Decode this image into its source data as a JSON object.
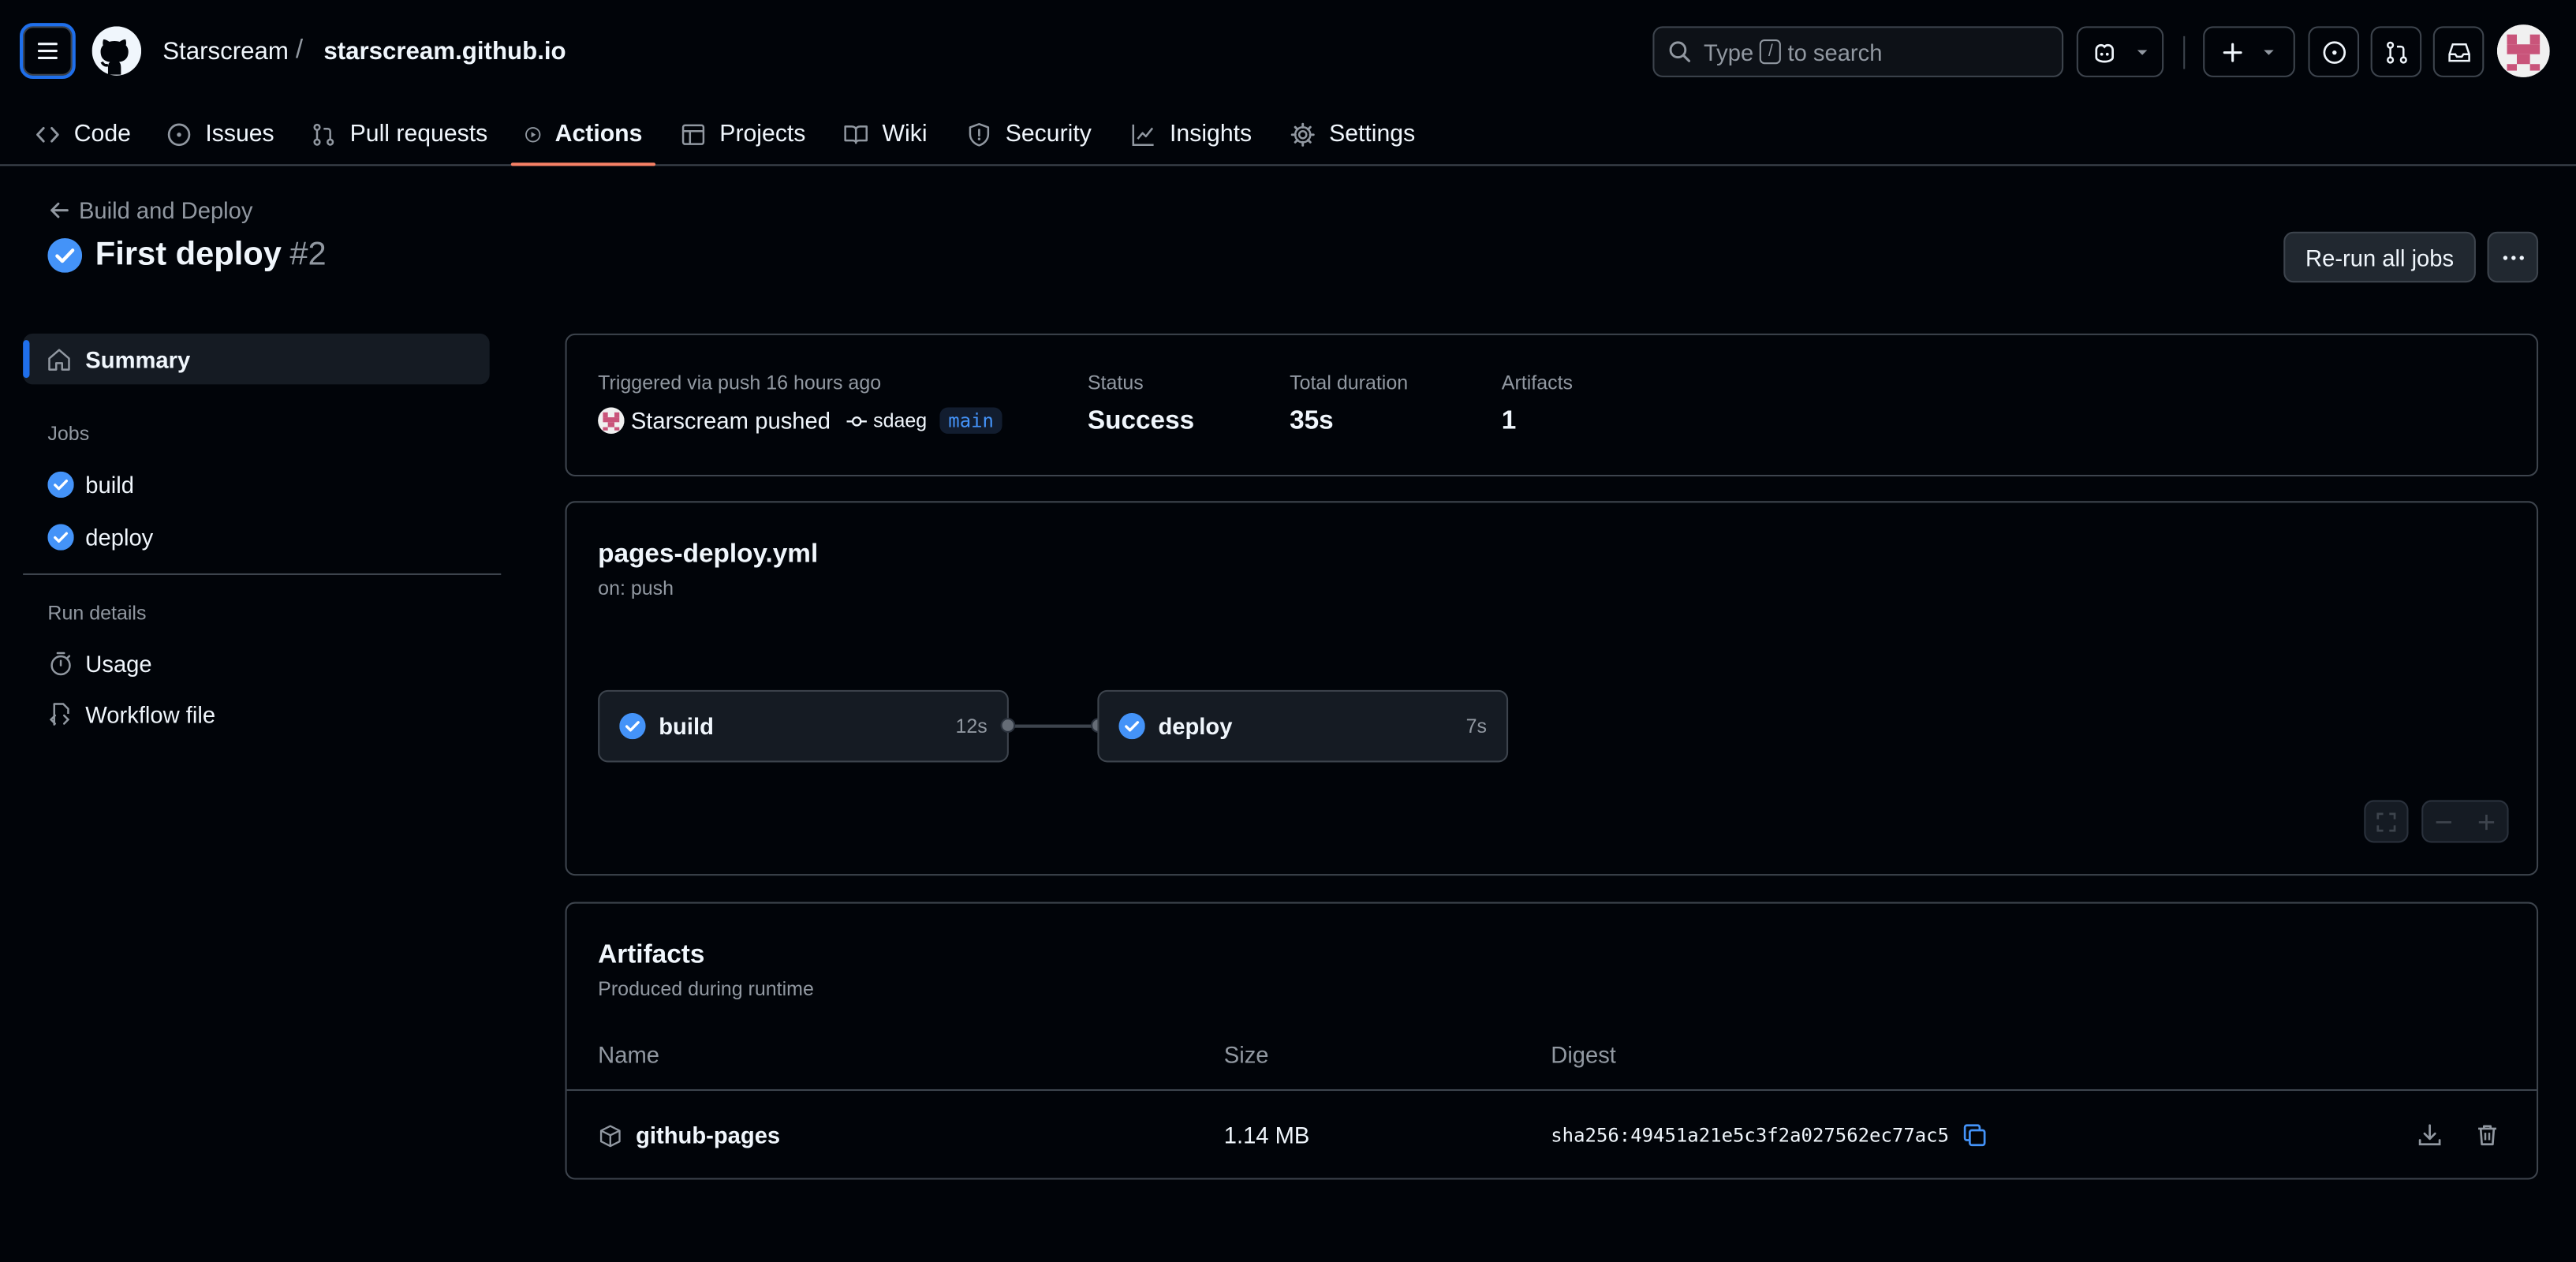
{
  "header": {
    "owner": "Starscream",
    "separator": "/",
    "repo": "starscream.github.io",
    "search_prefix": "Type",
    "search_key": "/",
    "search_suffix": "to search"
  },
  "nav": {
    "tabs": [
      {
        "label": "Code",
        "icon": "code-icon"
      },
      {
        "label": "Issues",
        "icon": "issue-opened-icon"
      },
      {
        "label": "Pull requests",
        "icon": "git-pull-request-icon"
      },
      {
        "label": "Actions",
        "icon": "play-icon",
        "active": true
      },
      {
        "label": "Projects",
        "icon": "table-icon"
      },
      {
        "label": "Wiki",
        "icon": "book-icon"
      },
      {
        "label": "Security",
        "icon": "shield-icon"
      },
      {
        "label": "Insights",
        "icon": "graph-icon"
      },
      {
        "label": "Settings",
        "icon": "gear-icon"
      }
    ]
  },
  "run": {
    "back_label": "Build and Deploy",
    "title": "First deploy",
    "number": "#2",
    "rerun_label": "Re-run all jobs"
  },
  "sidebar": {
    "summary_label": "Summary",
    "jobs_heading": "Jobs",
    "jobs": [
      "build",
      "deploy"
    ],
    "run_details_heading": "Run details",
    "usage_label": "Usage",
    "workflow_file_label": "Workflow file"
  },
  "summary": {
    "triggered": "Triggered via push 16 hours ago",
    "actor": "Starscream",
    "pushed_word": "pushed",
    "commit": "sdaeg",
    "branch": "main",
    "status_label": "Status",
    "status_value": "Success",
    "duration_label": "Total duration",
    "duration_value": "35s",
    "artifacts_label": "Artifacts",
    "artifacts_value": "1"
  },
  "workflow": {
    "file": "pages-deploy.yml",
    "trigger": "on: push",
    "jobs": [
      {
        "name": "build",
        "duration": "12s"
      },
      {
        "name": "deploy",
        "duration": "7s"
      }
    ]
  },
  "artifacts": {
    "title": "Artifacts",
    "subtitle": "Produced during runtime",
    "columns": {
      "name": "Name",
      "size": "Size",
      "digest": "Digest"
    },
    "rows": [
      {
        "name": "github-pages",
        "size": "1.14 MB",
        "digest": "sha256:49451a21e5c3f2a027562ec77ac5"
      }
    ]
  },
  "colors": {
    "accent": "#1f6feb",
    "success": "#4493f8",
    "active_tab_underline": "#f78166"
  }
}
